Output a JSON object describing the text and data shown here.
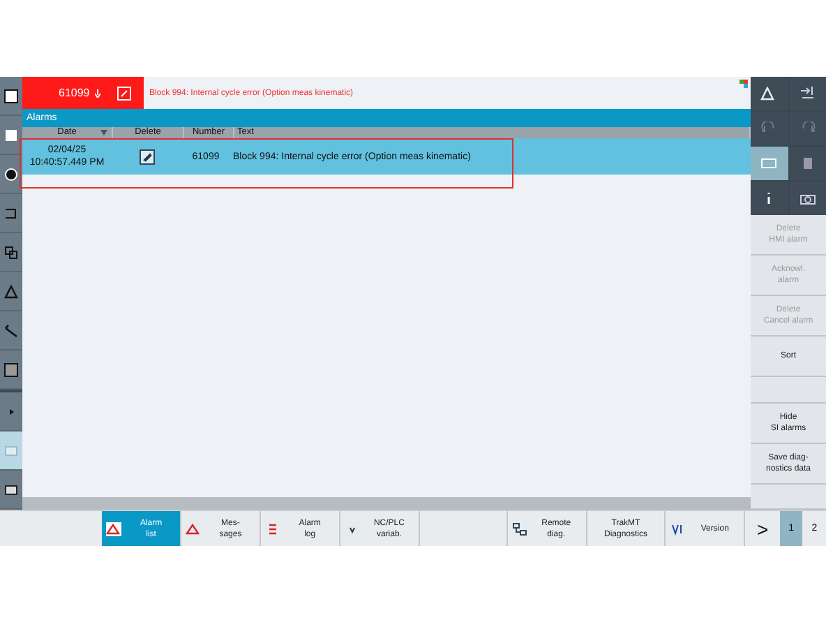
{
  "header": {
    "alarm_number": "61099",
    "alarm_text": "Block 994: Internal cycle error (Option meas kinematic)"
  },
  "panel": {
    "title": "Alarms"
  },
  "table": {
    "columns": [
      {
        "label": "Date",
        "sorted": true
      },
      {
        "label": "Delete",
        "sorted": false
      },
      {
        "label": "Number",
        "sorted": false
      },
      {
        "label": "Text",
        "sorted": false
      }
    ],
    "rows": [
      {
        "date": "02/04/25",
        "time": "10:40:57.449 PM",
        "number": "61099",
        "text": "Block 994: Internal cycle error (Option meas kinematic)",
        "selected": true
      }
    ]
  },
  "vertical_softkeys": [
    {
      "kind": "key",
      "label": "Delete\nHMI alarm",
      "disabled": true
    },
    {
      "kind": "key",
      "label": "Acknowl.\nalarm",
      "disabled": true
    },
    {
      "kind": "key",
      "label": "Delete\nCancel alarm",
      "disabled": true
    },
    {
      "kind": "key",
      "label": "Sort",
      "disabled": false
    },
    {
      "kind": "blank"
    },
    {
      "kind": "key",
      "label": "Hide\nSI alarms",
      "disabled": false
    },
    {
      "kind": "key",
      "label": "Save diag-\nnostics data",
      "disabled": false
    },
    {
      "kind": "blank"
    }
  ],
  "horizontal_softkeys": [
    {
      "kind": "key",
      "label": "Alarm\nlist",
      "selected": true
    },
    {
      "kind": "key",
      "label": "Mes-\nsages",
      "selected": false
    },
    {
      "kind": "key",
      "label": "Alarm\nlog",
      "selected": false
    },
    {
      "kind": "key",
      "label": "NC/PLC\nvariab.",
      "selected": false
    },
    {
      "kind": "blank"
    },
    {
      "kind": "key",
      "label": "Remote\ndiag.",
      "selected": false
    },
    {
      "kind": "key",
      "label": "TrakMT\nDiagnostics",
      "selected": false
    },
    {
      "kind": "key",
      "label": "Version",
      "selected": false
    }
  ],
  "next_key": ">",
  "pages": [
    {
      "label": "1",
      "selected": true
    },
    {
      "label": "2",
      "selected": false
    }
  ]
}
